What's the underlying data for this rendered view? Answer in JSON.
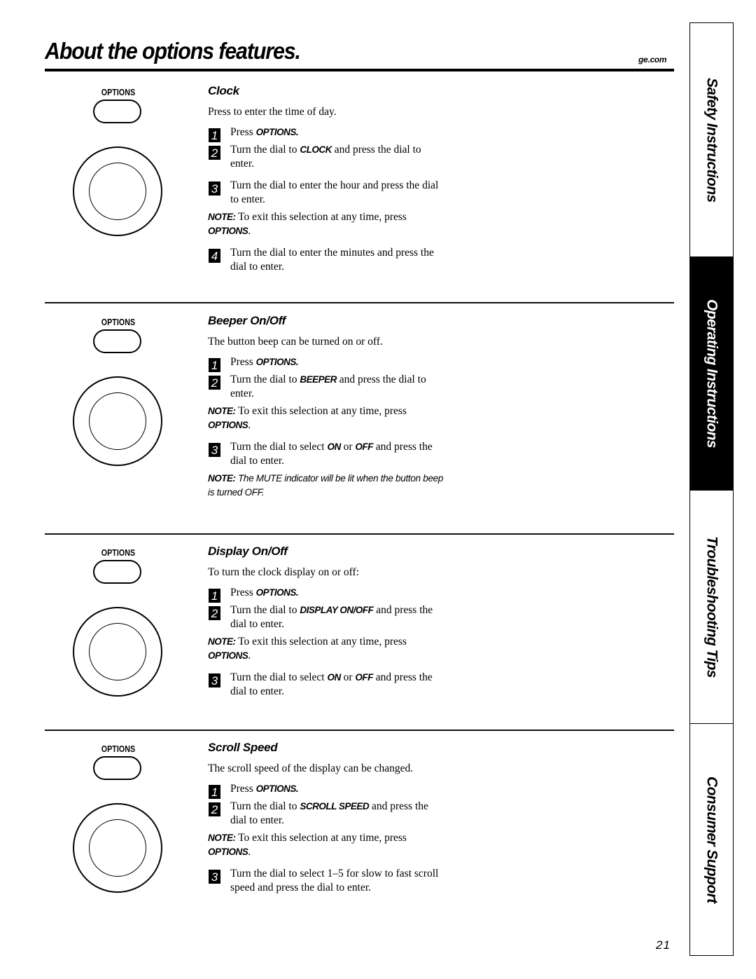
{
  "header": {
    "title": "About the options features.",
    "site": "ge.com"
  },
  "control_labels": {
    "options_key": "OPTIONS"
  },
  "sections": [
    {
      "heading": "Clock",
      "intro": "Press to enter the time of day.",
      "blocks": [
        {
          "type": "step",
          "number": "1",
          "parts": [
            {
              "t": "Press "
            },
            {
              "k": "OPTIONS."
            }
          ]
        },
        {
          "type": "step",
          "number": "2",
          "parts": [
            {
              "t": "Turn the dial to "
            },
            {
              "k": "CLOCK"
            },
            {
              "t": " and press the dial to enter."
            }
          ]
        },
        {
          "type": "step",
          "number": "3",
          "parts": [
            {
              "t": "Turn the dial to enter the hour and press the dial to enter."
            }
          ]
        },
        {
          "type": "note",
          "label": "NOTE:",
          "parts": [
            {
              "t": " To exit this selection at any time, press "
            },
            {
              "k": "OPTIONS"
            },
            {
              "t": "."
            }
          ]
        },
        {
          "type": "step",
          "number": "4",
          "parts": [
            {
              "t": "Turn the dial to enter the minutes and press the dial to enter."
            }
          ]
        }
      ]
    },
    {
      "heading": "Beeper On/Off",
      "intro": "The button beep can be turned on or off.",
      "blocks": [
        {
          "type": "step",
          "number": "1",
          "parts": [
            {
              "t": "Press "
            },
            {
              "k": "OPTIONS."
            }
          ]
        },
        {
          "type": "step",
          "number": "2",
          "parts": [
            {
              "t": "Turn the dial to "
            },
            {
              "k": "BEEPER"
            },
            {
              "t": " and press the dial to enter."
            }
          ]
        },
        {
          "type": "note",
          "label": "NOTE:",
          "parts": [
            {
              "t": " To exit this selection at any time, press "
            },
            {
              "k": "OPTIONS"
            },
            {
              "t": "."
            }
          ]
        },
        {
          "type": "step",
          "number": "3",
          "parts": [
            {
              "t": "Turn the dial to select "
            },
            {
              "k": "ON"
            },
            {
              "t": " or "
            },
            {
              "k": "OFF"
            },
            {
              "t": " and press the dial to enter."
            }
          ]
        },
        {
          "type": "note-italic",
          "label": "NOTE:",
          "text": " The MUTE indicator will be lit when the button beep is turned OFF."
        }
      ]
    },
    {
      "heading": "Display On/Off",
      "intro": "To turn the clock display on or off:",
      "blocks": [
        {
          "type": "step",
          "number": "1",
          "parts": [
            {
              "t": "Press "
            },
            {
              "k": "OPTIONS."
            }
          ]
        },
        {
          "type": "step",
          "number": "2",
          "parts": [
            {
              "t": "Turn the dial to "
            },
            {
              "k": "DISPLAY ON/OFF"
            },
            {
              "t": " and press the dial to enter."
            }
          ]
        },
        {
          "type": "note",
          "label": "NOTE:",
          "parts": [
            {
              "t": " To exit this selection at any time, press "
            },
            {
              "k": "OPTIONS"
            },
            {
              "t": "."
            }
          ]
        },
        {
          "type": "step",
          "number": "3",
          "parts": [
            {
              "t": "Turn the dial to select "
            },
            {
              "k": "ON"
            },
            {
              "t": " or "
            },
            {
              "k": "OFF"
            },
            {
              "t": " and press the dial to enter."
            }
          ]
        }
      ]
    },
    {
      "heading": "Scroll Speed",
      "intro": "The scroll speed of the display can be changed.",
      "blocks": [
        {
          "type": "step",
          "number": "1",
          "parts": [
            {
              "t": "Press "
            },
            {
              "k": "OPTIONS."
            }
          ]
        },
        {
          "type": "step",
          "number": "2",
          "parts": [
            {
              "t": "Turn the dial to "
            },
            {
              "k": "SCROLL SPEED"
            },
            {
              "t": " and press the dial to enter."
            }
          ]
        },
        {
          "type": "note",
          "label": "NOTE:",
          "parts": [
            {
              "t": " To exit this selection at any time, press "
            },
            {
              "k": "OPTIONS"
            },
            {
              "t": "."
            }
          ]
        },
        {
          "type": "step",
          "number": "3",
          "parts": [
            {
              "t": "Turn the dial to select 1–5 for slow to fast scroll speed and press the dial to enter."
            }
          ]
        }
      ]
    }
  ],
  "side_tabs": [
    {
      "label": "Safety Instructions",
      "active": false
    },
    {
      "label": "Operating Instructions",
      "active": true
    },
    {
      "label": "Troubleshooting Tips",
      "active": false
    },
    {
      "label": "Consumer Support",
      "active": false
    }
  ],
  "footer": {
    "page_number": "21"
  }
}
